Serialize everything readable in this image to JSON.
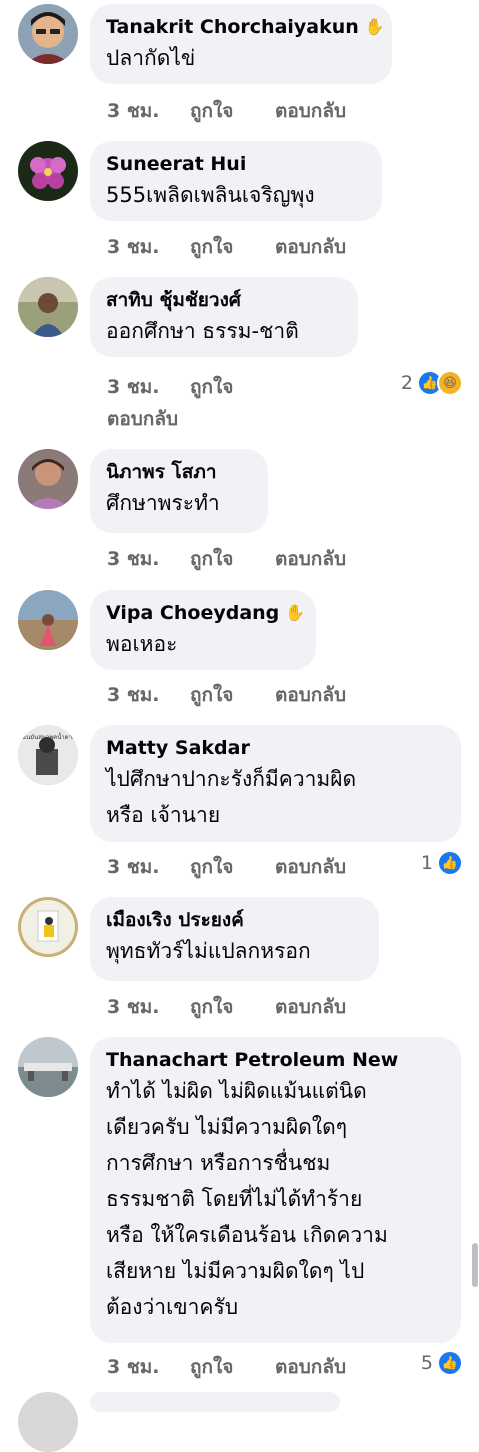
{
  "comments": [
    {
      "name": "Tanakrit Chorchaiyakun",
      "wave": true,
      "text_lines": [
        "ปลากัดไข่"
      ],
      "time": "3 ชม.",
      "like": "ถูกใจ",
      "reply": "ตอบกลับ",
      "reaction_count": ""
    },
    {
      "name": "Suneerat Hui",
      "wave": false,
      "text_lines": [
        "555เพลิดเพลินเจริญพุง"
      ],
      "time": "3 ชม.",
      "like": "ถูกใจ",
      "reply": "ตอบกลับ",
      "reaction_count": ""
    },
    {
      "name": "สาทิบ ชุ้มชัยวงศ์",
      "wave": false,
      "text_lines": [
        "ออกศึกษา ธรรม-ชาติ"
      ],
      "time": "3 ชม.",
      "like": "ถูกใจ",
      "reply": "ตอบกลับ",
      "reaction_count": "2"
    },
    {
      "name": "นิภาพร โสภา",
      "wave": false,
      "text_lines": [
        "ศึกษาพระทำ"
      ],
      "time": "3 ชม.",
      "like": "ถูกใจ",
      "reply": "ตอบกลับ",
      "reaction_count": ""
    },
    {
      "name": "Vipa Choeydang",
      "wave": true,
      "text_lines": [
        "พอเหอะ"
      ],
      "time": "3 ชม.",
      "like": "ถูกใจ",
      "reply": "ตอบกลับ",
      "reaction_count": ""
    },
    {
      "name": "Matty Sakdar",
      "wave": false,
      "text_lines": [
        "ไปศึกษาปากะรังก็มีความผิด",
        "หรือ เจ้านาย"
      ],
      "time": "3 ชม.",
      "like": "ถูกใจ",
      "reply": "ตอบกลับ",
      "reaction_count": "1"
    },
    {
      "name": "เมืองเริง ประยงค์",
      "wave": false,
      "text_lines": [
        "พุทธทัวร์ไม่แปลกหรอก"
      ],
      "time": "3 ชม.",
      "like": "ถูกใจ",
      "reply": "ตอบกลับ",
      "reaction_count": ""
    },
    {
      "name": "Thanachart Petroleum New",
      "wave": false,
      "text_lines": [
        "ทำได้ ไม่ผิด  ไม่ผิดแม้นแต่นิด",
        "เดียวครับ  ไม่มีความผิดใดๆ",
        "การศึกษา หรือการชื่นชม",
        "ธรรมชาติ  โดยที่ไม่ได้ทำร้าย",
        "หรือ ให้ใครเดือนร้อน  เกิดความ",
        "เสียหาย  ไม่มีความผิดใดๆ  ไป",
        "ต้องว่าเขาครับ"
      ],
      "time": "3 ชม.",
      "like": "ถูกใจ",
      "reply": "ตอบกลับ",
      "reaction_count": "5"
    }
  ],
  "colors": {
    "bubble": "#f0f2f5",
    "meta": "#65676b",
    "like_blue": "#1877f2",
    "haha_yellow": "#f7b125"
  },
  "avatar_label": "ฉันมันสมาพคน้ำตาลดีเคิ่ม"
}
